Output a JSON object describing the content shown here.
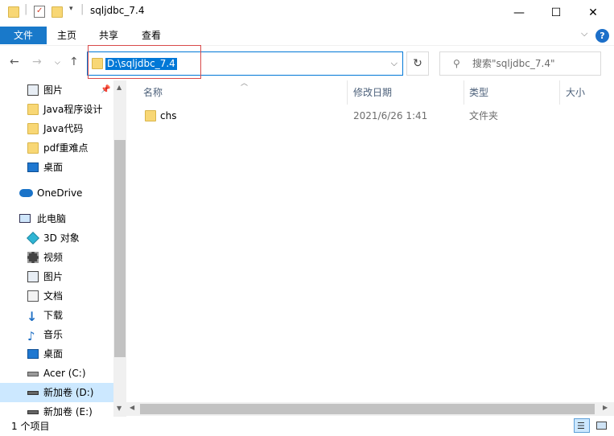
{
  "window": {
    "title": "sqljdbc_7.4",
    "minimize": "—",
    "maximize": "☐",
    "close": "✕"
  },
  "ribbon": {
    "tabs": [
      "文件",
      "主页",
      "共享",
      "查看"
    ],
    "help": "?"
  },
  "address": {
    "path": "D:\\sqljdbc_7.4",
    "search_placeholder": "搜索\"sqljdbc_7.4\""
  },
  "sidebar": {
    "items": [
      {
        "label": "图片",
        "icon": "pictures-icon",
        "pinned": true
      },
      {
        "label": "Java程序设计",
        "icon": "folder-icon"
      },
      {
        "label": "Java代码",
        "icon": "folder-icon"
      },
      {
        "label": "pdf重难点",
        "icon": "folder-icon"
      },
      {
        "label": "桌面",
        "icon": "desktop-icon"
      },
      {
        "label": "OneDrive",
        "icon": "onedrive-icon"
      },
      {
        "label": "此电脑",
        "icon": "this-pc-icon"
      },
      {
        "label": "3D 对象",
        "icon": "3d-objects-icon"
      },
      {
        "label": "视频",
        "icon": "videos-icon"
      },
      {
        "label": "图片",
        "icon": "pictures-icon"
      },
      {
        "label": "文档",
        "icon": "documents-icon"
      },
      {
        "label": "下载",
        "icon": "downloads-icon"
      },
      {
        "label": "音乐",
        "icon": "music-icon"
      },
      {
        "label": "桌面",
        "icon": "desktop-icon"
      },
      {
        "label": "Acer (C:)",
        "icon": "drive-c-icon"
      },
      {
        "label": "新加卷 (D:)",
        "icon": "drive-d-icon",
        "selected": true
      },
      {
        "label": "新加卷 (E:)",
        "icon": "drive-e-icon"
      }
    ]
  },
  "columns": [
    "名称",
    "修改日期",
    "类型",
    "大小"
  ],
  "files": [
    {
      "name": "chs",
      "modified": "2021/6/26 1:41",
      "type": "文件夹",
      "size": ""
    }
  ],
  "status": {
    "count": "1 个项目"
  },
  "colors": {
    "accent": "#0078d7",
    "file_tab": "#1979ca",
    "selection": "#cce8ff",
    "folder": "#f8d775",
    "highlight_box": "#d94a4a"
  }
}
